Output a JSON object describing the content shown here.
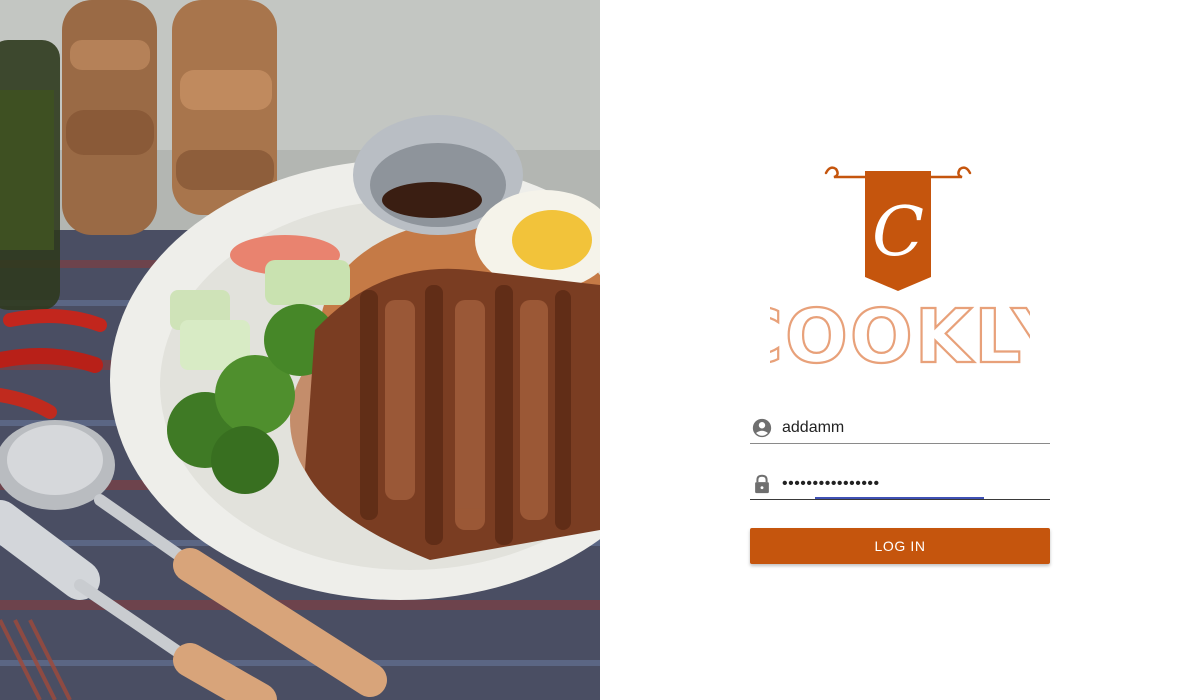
{
  "brand": {
    "name": "COOKLY",
    "monogram": "C",
    "accent_color": "#c5550d",
    "logo_text_color": "#e8a17a"
  },
  "hero": {
    "image_subject": "food-photo"
  },
  "login_form": {
    "username": {
      "value": "addamm",
      "icon": "account-circle-icon"
    },
    "password": {
      "value": "••••••••••••••••",
      "icon": "lock-icon"
    },
    "submit_label": "LOG IN"
  }
}
